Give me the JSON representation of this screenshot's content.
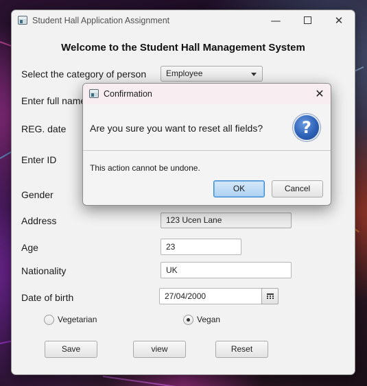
{
  "window": {
    "title": "Student Hall Application Assignment",
    "minimize_glyph": "—",
    "close_glyph": "✕"
  },
  "form": {
    "heading": "Welcome to the Student Hall Management System",
    "category_label": "Select the category of person",
    "category_value": "Employee",
    "fullname_label": "Enter full name",
    "regdate_label": "REG. date",
    "id_label": "Enter ID",
    "gender_label": "Gender",
    "address_label": "Address",
    "address_value": "123 Ucen Lane",
    "age_label": "Age",
    "age_value": "23",
    "nationality_label": "Nationality",
    "nationality_value": "UK",
    "dob_label": "Date of birth",
    "dob_value": "27/04/2000",
    "diet_options": [
      {
        "label": "Vegetarian",
        "selected": false
      },
      {
        "label": "Vegan",
        "selected": true
      }
    ],
    "buttons": {
      "save": "Save",
      "view": "view",
      "reset": "Reset"
    }
  },
  "dialog": {
    "title": "Confirmation",
    "close_glyph": "✕",
    "question": "Are you sure you want to reset all fields?",
    "question_icon": "question-icon",
    "content": "This action cannot be undone.",
    "ok_label": "OK",
    "cancel_label": "Cancel",
    "question_mark": "?"
  },
  "colors": {
    "ok_button_accent": "#3a8ad6",
    "question_icon_blue": "#2e62b8"
  }
}
